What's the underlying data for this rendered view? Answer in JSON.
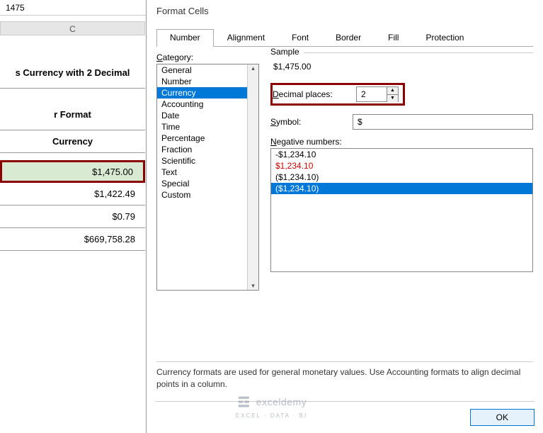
{
  "formula_bar": {
    "value": "1475"
  },
  "col_header": "C",
  "sheet": {
    "title1": "s Currency with 2  Decimal",
    "title2": "r Format",
    "header": "Currency",
    "rows": [
      "$1,475.00",
      "$1,422.49",
      "$0.79",
      "$669,758.28"
    ]
  },
  "dialog": {
    "title": "Format Cells",
    "tabs": [
      "Number",
      "Alignment",
      "Font",
      "Border",
      "Fill",
      "Protection"
    ],
    "category_label": "Category:",
    "categories": [
      "General",
      "Number",
      "Currency",
      "Accounting",
      "Date",
      "Time",
      "Percentage",
      "Fraction",
      "Scientific",
      "Text",
      "Special",
      "Custom"
    ],
    "selected_category": "Currency",
    "sample_label": "Sample",
    "sample_value": "$1,475.00",
    "decimal_label": "Decimal places:",
    "decimal_value": "2",
    "symbol_label": "Symbol:",
    "symbol_value": "$",
    "neg_label": "Negative numbers:",
    "neg_items": [
      {
        "text": "-$1,234.10",
        "red": false
      },
      {
        "text": "$1,234.10",
        "red": true
      },
      {
        "text": "($1,234.10)",
        "red": false
      },
      {
        "text": "($1,234.10)",
        "red": true
      }
    ],
    "desc": "Currency formats are used for general monetary values.  Use Accounting formats to align decimal points in a column.",
    "ok": "OK"
  },
  "watermark": {
    "brand": "exceldemy",
    "sub": "EXCEL · DATA · BI"
  }
}
